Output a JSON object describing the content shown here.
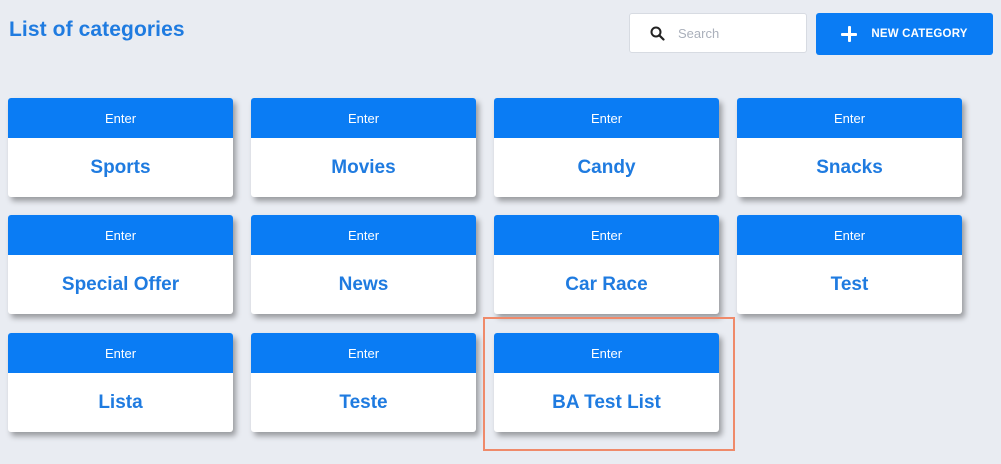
{
  "header": {
    "title": "List of categories"
  },
  "search": {
    "placeholder": "Search",
    "icon": "search-icon"
  },
  "new_category_button": {
    "label": "NEW CATEGORY",
    "icon": "plus-icon"
  },
  "colors": {
    "accent": "#0a7cf4",
    "title_text": "#1f7be0",
    "background": "#e9ecf2",
    "highlight_border": "#ef8a6a"
  },
  "categories": [
    {
      "enter_label": "Enter",
      "name": "Sports"
    },
    {
      "enter_label": "Enter",
      "name": "Movies"
    },
    {
      "enter_label": "Enter",
      "name": "Candy"
    },
    {
      "enter_label": "Enter",
      "name": "Snacks"
    },
    {
      "enter_label": "Enter",
      "name": "Special Offer"
    },
    {
      "enter_label": "Enter",
      "name": "News"
    },
    {
      "enter_label": "Enter",
      "name": "Car Race"
    },
    {
      "enter_label": "Enter",
      "name": "Test"
    },
    {
      "enter_label": "Enter",
      "name": "Lista"
    },
    {
      "enter_label": "Enter",
      "name": "Teste"
    },
    {
      "enter_label": "Enter",
      "name": "BA Test List"
    }
  ]
}
